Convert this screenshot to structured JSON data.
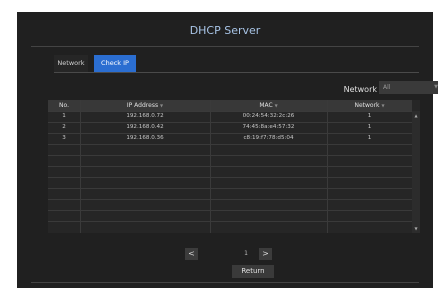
{
  "window": {
    "title": "DHCP Server"
  },
  "tabs": [
    {
      "label": "Network",
      "active": false
    },
    {
      "label": "Check IP",
      "active": true
    }
  ],
  "filter": {
    "label": "Network",
    "value": "All"
  },
  "table": {
    "columns": [
      {
        "label": "No."
      },
      {
        "label": "IP Address"
      },
      {
        "label": "MAC"
      },
      {
        "label": "Network"
      }
    ],
    "rows": [
      {
        "no": "1",
        "ip": "192.168.0.72",
        "mac": "00:24:54:32:2c:26",
        "network": "1"
      },
      {
        "no": "2",
        "ip": "192.168.0.42",
        "mac": "74:45:8a:e4:57:32",
        "network": "1"
      },
      {
        "no": "3",
        "ip": "192.168.0.36",
        "mac": "c8:19:f7:78:d5:04",
        "network": "1"
      }
    ]
  },
  "pagination": {
    "current": "1",
    "prev": "<",
    "next": ">"
  },
  "footer": {
    "return_label": "Return"
  },
  "colors": {
    "accent": "#2b6ed1",
    "title": "#a8c4e6",
    "panel": "#202020"
  }
}
